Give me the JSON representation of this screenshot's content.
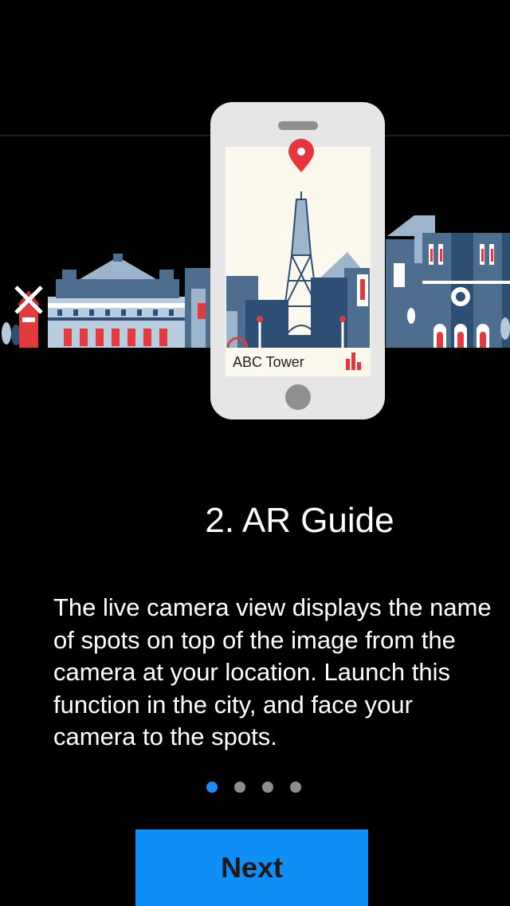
{
  "onboarding": {
    "phone_label": "ABC Tower",
    "title": "2. AR Guide",
    "description": "The live camera view displays the name\nof spots on top of the image from the\ncamera at your location. Launch this\nfunction in the city, and face your\ncamera to the spots.",
    "page_count": 4,
    "current_page": 1,
    "next_label": "Next"
  },
  "colors": {
    "background": "#000000",
    "accent_blue": "#1E8BF5",
    "button_blue": "#0F8EF5",
    "inactive_dot": "#8E8E8E",
    "pin_red": "#E8343C",
    "building_blue": "#4E6E90",
    "building_light": "#9DB5CC"
  },
  "icons": {
    "pin": "map-pin-icon",
    "bars": "bar-chart-icon",
    "windmill": "windmill-icon"
  }
}
